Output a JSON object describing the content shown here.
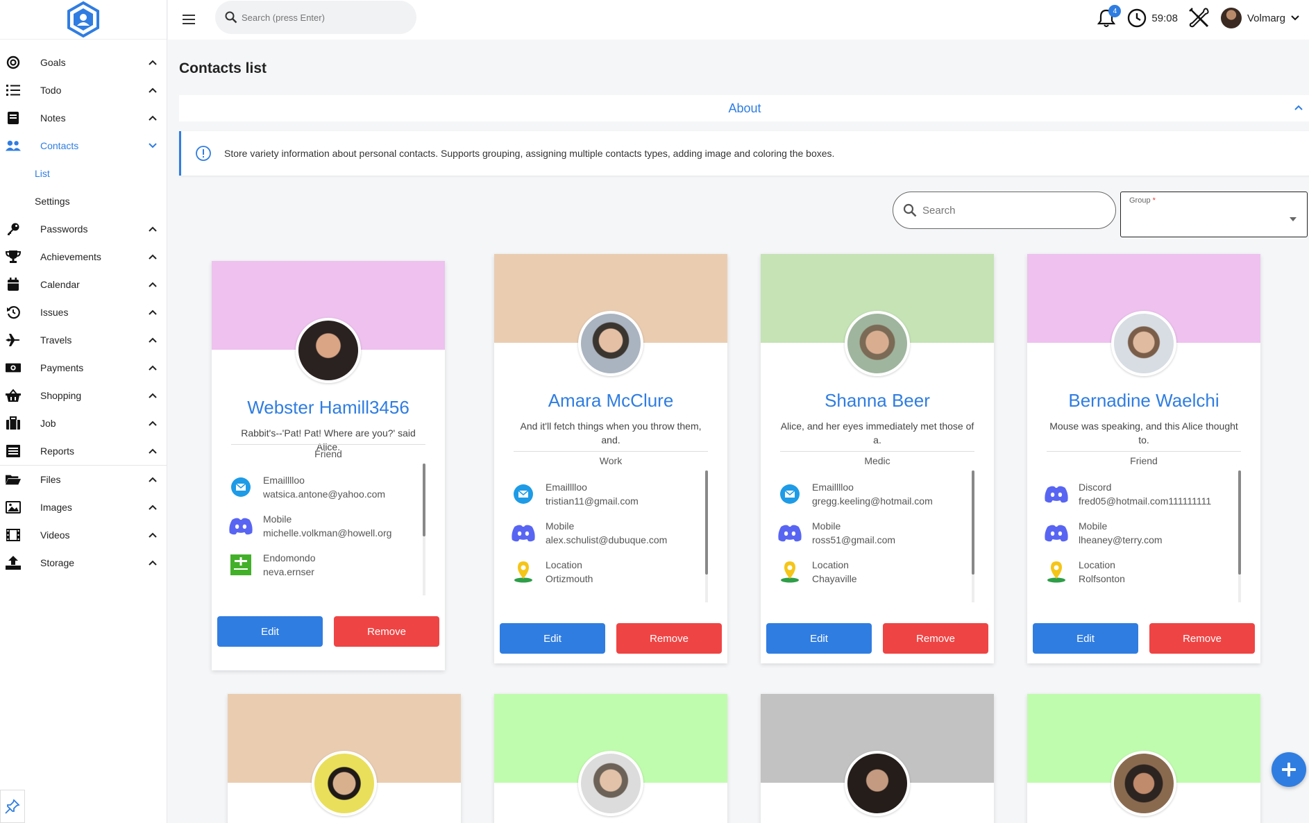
{
  "topbar": {
    "search_placeholder": "Search (press Enter)",
    "notification_count": "4",
    "timer": "59:08",
    "user_name": "Volmarg"
  },
  "sidebar": {
    "items": [
      {
        "label": "Goals",
        "icon": "target-icon"
      },
      {
        "label": "Todo",
        "icon": "list-icon"
      },
      {
        "label": "Notes",
        "icon": "notebook-icon"
      },
      {
        "label": "Contacts",
        "icon": "users-icon"
      },
      {
        "label": "Passwords",
        "icon": "key-icon"
      },
      {
        "label": "Achievements",
        "icon": "trophy-icon"
      },
      {
        "label": "Calendar",
        "icon": "calendar-icon"
      },
      {
        "label": "Issues",
        "icon": "history-icon"
      },
      {
        "label": "Travels",
        "icon": "plane-icon"
      },
      {
        "label": "Payments",
        "icon": "money-icon"
      },
      {
        "label": "Shopping",
        "icon": "basket-icon"
      },
      {
        "label": "Job",
        "icon": "briefcase-icon"
      },
      {
        "label": "Reports",
        "icon": "report-icon"
      },
      {
        "label": "Files",
        "icon": "folder-icon"
      },
      {
        "label": "Images",
        "icon": "image-icon"
      },
      {
        "label": "Videos",
        "icon": "film-icon"
      },
      {
        "label": "Storage",
        "icon": "upload-icon"
      }
    ],
    "contacts_sub": [
      "List",
      "Settings"
    ]
  },
  "main": {
    "title": "Contacts list",
    "about_title": "About",
    "about_text": "Store variety information about personal contacts. Supports grouping, assigning multiple contacts types, adding image and coloring the boxes.",
    "search_placeholder": "Search",
    "group_label": "Group",
    "group_required": "*"
  },
  "cards": [
    {
      "name": "Webster Hamill3456",
      "desc": "Rabbit's--'Pat! Pat! Where are you?' said Alice.",
      "type": "Friend",
      "color": "#eec1ef",
      "contacts": [
        {
          "icon": "email-icon",
          "label": "Emailllloo",
          "value": "watsica.antone@yahoo.com"
        },
        {
          "icon": "discord-icon",
          "label": "Mobile",
          "value": "michelle.volkman@howell.org"
        },
        {
          "icon": "endomondo-icon",
          "label": "Endomondo",
          "value": "neva.ernser"
        }
      ],
      "edit": "Edit",
      "remove": "Remove"
    },
    {
      "name": "Amara McClure",
      "desc": "And it'll fetch things when you throw them, and.",
      "type": "Work",
      "color": "#eacdb1",
      "contacts": [
        {
          "icon": "email-icon",
          "label": "Emailllloo",
          "value": "tristian11@gmail.com"
        },
        {
          "icon": "discord-icon",
          "label": "Mobile",
          "value": "alex.schulist@dubuque.com"
        },
        {
          "icon": "location-icon",
          "label": "Location",
          "value": "Ortizmouth"
        }
      ],
      "edit": "Edit",
      "remove": "Remove"
    },
    {
      "name": "Shanna Beer",
      "desc": "Alice, and her eyes immediately met those of a.",
      "type": "Medic",
      "color": "#c5e3b5",
      "contacts": [
        {
          "icon": "email-icon",
          "label": "Emailllloo",
          "value": "gregg.keeling@hotmail.com"
        },
        {
          "icon": "discord-icon",
          "label": "Mobile",
          "value": "ross51@gmail.com"
        },
        {
          "icon": "location-icon",
          "label": "Location",
          "value": "Chayaville"
        }
      ],
      "edit": "Edit",
      "remove": "Remove"
    },
    {
      "name": "Bernadine Waelchi",
      "desc": "Mouse was speaking, and this Alice thought to.",
      "type": "Friend",
      "color": "#eec1ef",
      "contacts": [
        {
          "icon": "discord-icon",
          "label": "Discord",
          "value": "fred05@hotmail.com111111111"
        },
        {
          "icon": "discord-icon",
          "label": "Mobile",
          "value": "lheaney@terry.com"
        },
        {
          "icon": "location-icon",
          "label": "Location",
          "value": "Rolfsonton"
        }
      ],
      "edit": "Edit",
      "remove": "Remove"
    }
  ],
  "cards_row2": [
    {
      "color": "#eacdb1"
    },
    {
      "color": "#c0fcad"
    },
    {
      "color": "#c3c2c3"
    },
    {
      "color": "#c0fcad"
    }
  ]
}
